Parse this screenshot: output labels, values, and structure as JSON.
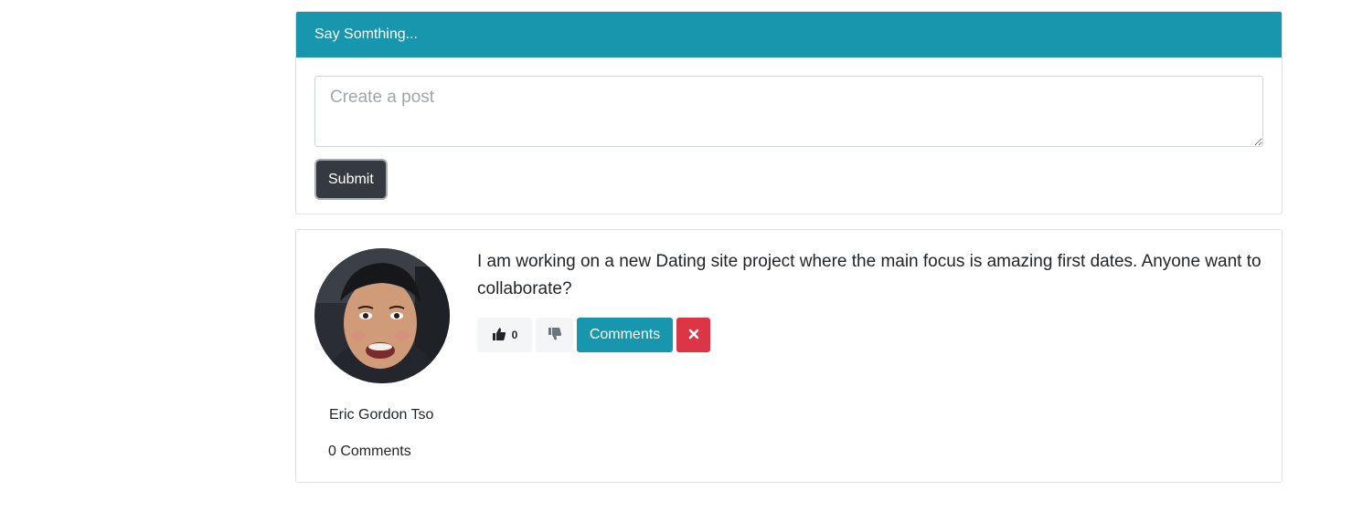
{
  "post_form": {
    "header_title": "Say Somthing...",
    "textarea_placeholder": "Create a post",
    "submit_label": "Submit"
  },
  "post": {
    "author_name": "Eric Gordon Tso",
    "comment_count_text": "0 Comments",
    "text": "I am working on a new Dating site project where the main focus is amazing first dates. Anyone want to collaborate?",
    "likes": "0",
    "comments_button_label": "Comments",
    "icons": {
      "like": "thumbs-up-icon",
      "dislike": "thumbs-down-icon",
      "delete": "close-icon"
    }
  },
  "colors": {
    "header_bg": "#1796ad",
    "comments_button": "#1796ad",
    "delete_button": "#dc3545",
    "submit_button": "#343a40"
  }
}
